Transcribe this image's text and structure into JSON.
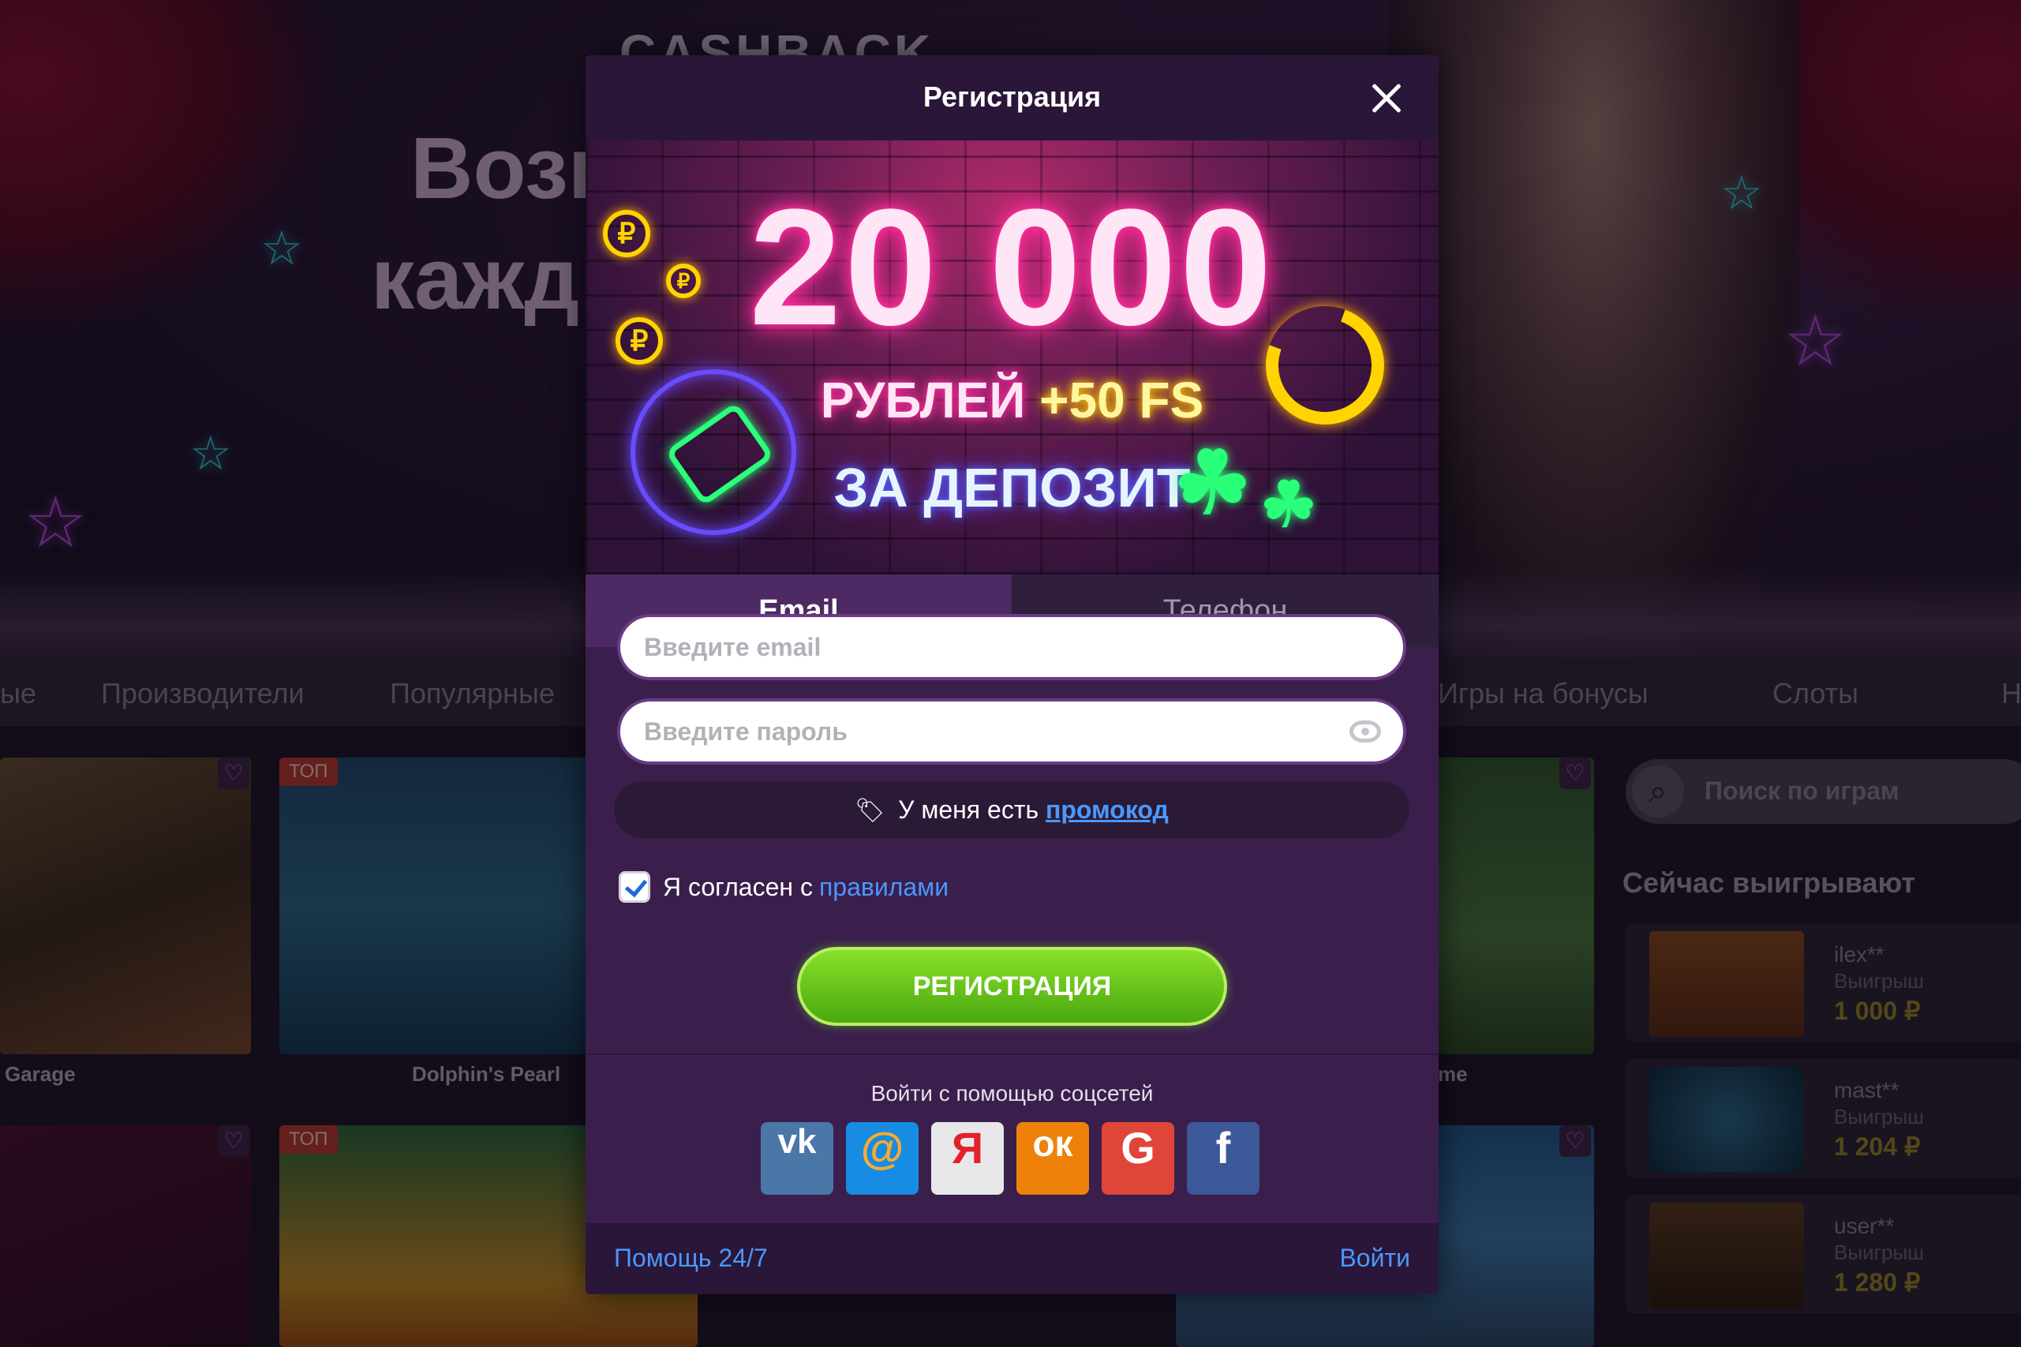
{
  "background": {
    "hero": {
      "cashback_text": "CASHBACK",
      "line1": "Возв",
      "line2": "кажд"
    },
    "nav": {
      "items": [
        "ые",
        "Производители",
        "Популярные",
        "Игры на бонусы",
        "Слоты",
        "Н"
      ]
    },
    "games": [
      {
        "title": "Garage",
        "badge": ""
      },
      {
        "title": "Dolphin's Pearl",
        "badge": "ТОП"
      },
      {
        "title": "me",
        "badge": ""
      },
      {
        "title": "",
        "badge": ""
      },
      {
        "title": "",
        "badge": "ТОП"
      },
      {
        "title": "",
        "badge": ""
      }
    ],
    "sidebar": {
      "search_placeholder": "Поиск по играм",
      "winners_title": "Сейчас выигрывают",
      "winners": [
        {
          "name": "ilex**",
          "label": "Выигрыш",
          "amount": "1 000 ₽"
        },
        {
          "name": "mast**",
          "label": "Выигрыш",
          "amount": "1 204 ₽"
        },
        {
          "name": "user**",
          "label": "Выигрыш",
          "amount": "1 280 ₽"
        }
      ]
    }
  },
  "modal": {
    "title": "Регистрация",
    "banner": {
      "amount": "20 000",
      "line2_a": "РУБЛЕЙ",
      "line2_b": "+50 FS",
      "line3": "ЗА ДЕПОЗИТ",
      "coin_symbol": "₽",
      "clover_symbol": "☘"
    },
    "tabs": {
      "email": "Email",
      "phone": "Телефон"
    },
    "email_placeholder": "Введите email",
    "password_placeholder": "Введите пароль",
    "promo": {
      "text": "У меня есть",
      "link": "промокод",
      "icon": "tag-icon"
    },
    "agree": {
      "text": "Я согласен с",
      "link": "правилами",
      "checked": true
    },
    "register_button": "РЕГИСТРАЦИЯ",
    "social_title": "Войти с помощью соцсетей",
    "socials": [
      {
        "label": "vk",
        "icon": "vk-icon",
        "color": "#4a76a8"
      },
      {
        "label": "@",
        "icon": "mailru-icon",
        "color": "#168de2"
      },
      {
        "label": "Я",
        "icon": "yandex-icon",
        "color": "#e8e8ea"
      },
      {
        "label": "ок",
        "icon": "odnoklassniki-icon",
        "color": "#ee8208"
      },
      {
        "label": "G",
        "icon": "google-icon",
        "color": "#e0453a"
      },
      {
        "label": "f",
        "icon": "facebook-icon",
        "color": "#3b5998"
      }
    ],
    "footer": {
      "help": "Помощь 24/7",
      "login": "Войти"
    }
  }
}
